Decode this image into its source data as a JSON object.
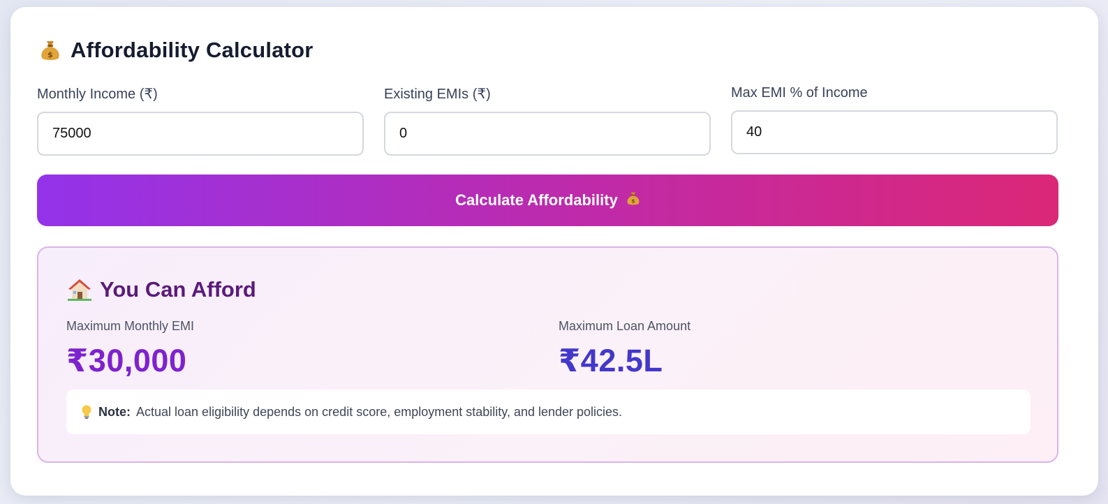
{
  "header": {
    "icon": "money-bag-icon",
    "title": "Affordability Calculator"
  },
  "fields": [
    {
      "label": "Monthly Income (₹)",
      "value": "75000"
    },
    {
      "label": "Existing EMIs (₹)",
      "value": "0"
    },
    {
      "label": "Max EMI % of Income",
      "value": "40"
    }
  ],
  "calculate_button": {
    "label": "Calculate Affordability",
    "icon": "money-bag-icon"
  },
  "result": {
    "icon": "house-icon",
    "title": "You Can Afford",
    "metrics": [
      {
        "label": "Maximum Monthly EMI",
        "value": "₹30,000",
        "color": "#7e22ce"
      },
      {
        "label": "Maximum Loan Amount",
        "value": "₹42.5L",
        "color": "#4338ca"
      }
    ],
    "note": {
      "icon": "lightbulb-icon",
      "prefix": "Note:",
      "text": "Actual loan eligibility depends on credit score, employment stability, and lender policies."
    }
  },
  "colors": {
    "button_gradient_start": "#9333ea",
    "button_gradient_end": "#db2777",
    "result_title": "#5b1a7a"
  }
}
